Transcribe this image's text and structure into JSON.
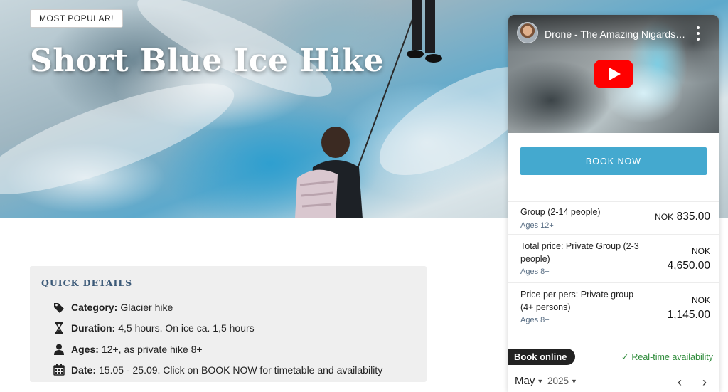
{
  "hero": {
    "badge": "MOST POPULAR!",
    "title": "Short Blue Ice Hike"
  },
  "quick_details": {
    "heading": "QUICK DETAILS",
    "items": [
      {
        "icon": "tag-icon",
        "label": "Category:",
        "value": "Glacier hike"
      },
      {
        "icon": "hourglass-icon",
        "label": "Duration:",
        "value": "4,5 hours. On ice ca. 1,5 hours"
      },
      {
        "icon": "person-icon",
        "label": "Ages:",
        "value": "12+, as private hike 8+"
      },
      {
        "icon": "calendar-icon",
        "label": "Date:",
        "value": "15.05 - 25.09. Click on BOOK NOW for timetable and availability"
      }
    ]
  },
  "booking": {
    "video_title": "Drone - The Amazing Nigardsbreen Glacier",
    "book_button": "BOOK NOW",
    "prices": [
      {
        "desc": "Group (2-14 people)",
        "age": "Ages 12+",
        "currency": "NOK",
        "amount": "835.00"
      },
      {
        "desc": "Total price: Private Group (2-3 people)",
        "age": "Ages 8+",
        "currency": "NOK",
        "amount": "4,650.00"
      },
      {
        "desc": "Price per pers: Private group (4+ persons)",
        "age": "Ages 8+",
        "currency": "NOK",
        "amount": "1,145.00"
      }
    ],
    "book_online": "Book online",
    "realtime": "Real-time availability",
    "month": "May",
    "year": "2025"
  },
  "colors": {
    "accent": "#44a9cf",
    "heading_blue": "#3c5a78",
    "success_green": "#2e8b3a",
    "youtube_red": "#ff0000"
  }
}
